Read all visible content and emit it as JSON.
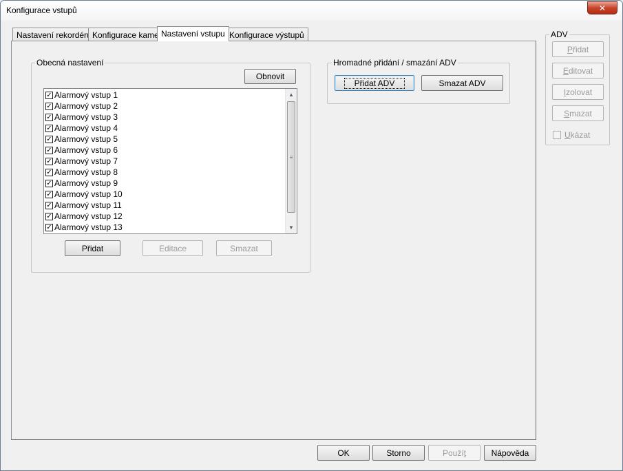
{
  "window": {
    "title": "Konfigurace vstupů",
    "close_glyph": "✕"
  },
  "tabs": [
    {
      "label": "Nastavení rekordéru",
      "active": false
    },
    {
      "label": "Konfigurace kamer",
      "active": false
    },
    {
      "label": "Nastavení vstupu",
      "active": true
    },
    {
      "label": "Konfigurace výstupů",
      "active": false
    }
  ],
  "general": {
    "title": "Obecná nastavení",
    "refresh_label": "Obnovit",
    "items": [
      {
        "label": "Alarmový vstup 1",
        "checked": true
      },
      {
        "label": "Alarmový vstup 2",
        "checked": true
      },
      {
        "label": "Alarmový vstup 3",
        "checked": true
      },
      {
        "label": "Alarmový vstup 4",
        "checked": true
      },
      {
        "label": "Alarmový vstup 5",
        "checked": true
      },
      {
        "label": "Alarmový vstup 6",
        "checked": true
      },
      {
        "label": "Alarmový vstup 7",
        "checked": true
      },
      {
        "label": "Alarmový vstup 8",
        "checked": true
      },
      {
        "label": "Alarmový vstup 9",
        "checked": true
      },
      {
        "label": "Alarmový vstup 10",
        "checked": true
      },
      {
        "label": "Alarmový vstup 11",
        "checked": true
      },
      {
        "label": "Alarmový vstup 12",
        "checked": true
      },
      {
        "label": "Alarmový vstup 13",
        "checked": true
      }
    ],
    "check_glyph": "✓",
    "add_label": "Přidat",
    "edit_label": "Editace",
    "delete_label": "Smazat"
  },
  "bulk": {
    "title": "Hromadné přidání / smazání ADV",
    "add_label": "Přidat ADV",
    "delete_label": "Smazat ADV"
  },
  "adv": {
    "title": "ADV",
    "add_label": "Přidat",
    "add_mnemonic": "P",
    "add_rest": "řidat",
    "edit_mnemonic": "E",
    "edit_rest": "ditovat",
    "isolate_mnemonic": "I",
    "isolate_rest": "zolovat",
    "delete_mnemonic": "S",
    "delete_rest": "mazat",
    "show_mnemonic": "U",
    "show_rest": "kázat"
  },
  "footer": {
    "ok_label": "OK",
    "cancel_label": "Storno",
    "apply_label": "Použí",
    "apply_mnemonic": "t",
    "help_label": "Nápověda"
  }
}
